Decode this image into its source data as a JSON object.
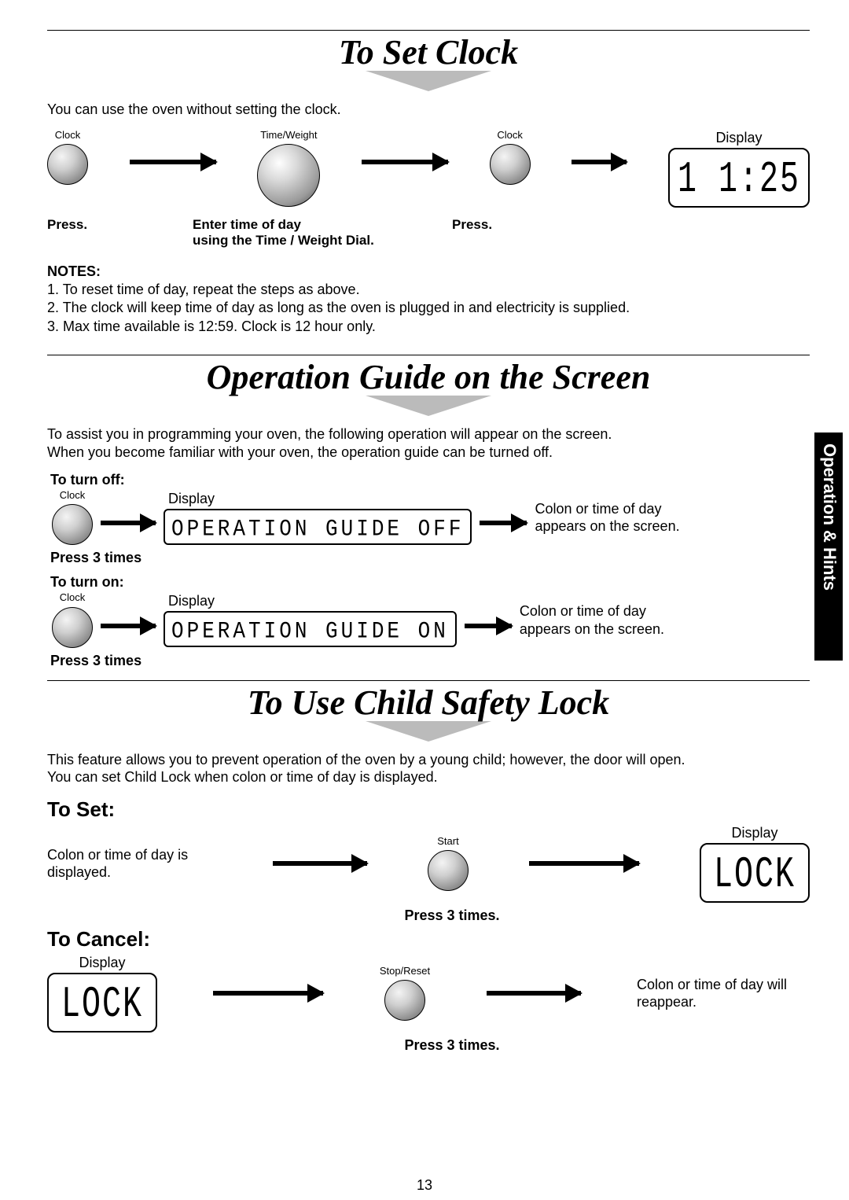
{
  "sidebar_tab": "Operation & Hints",
  "page_number": "13",
  "sections": {
    "clock": {
      "title": "To Set Clock",
      "intro": "You can use the oven without setting the clock.",
      "step1": {
        "label": "Clock",
        "caption": "Press."
      },
      "step2": {
        "label": "Time/Weight",
        "caption": "Enter time of day\nusing the Time / Weight Dial."
      },
      "step3": {
        "label": "Clock",
        "caption": "Press."
      },
      "display": {
        "label": "Display",
        "value": "1 1:25"
      },
      "notes_label": "NOTES:",
      "notes": [
        "1. To reset time of day, repeat the steps as above.",
        "2. The clock will keep time of day as long as the oven is plugged in and electricity is supplied.",
        "3. Max time available is 12:59. Clock is 12 hour only."
      ]
    },
    "opguide": {
      "title": "Operation Guide on the Screen",
      "intro": "To assist you in programming your oven, the following operation will appear on the screen.\nWhen you become familiar with your oven, the operation guide can be turned off.",
      "off": {
        "heading": "To turn off:",
        "button_label": "Clock",
        "caption": "Press 3 times",
        "display_label": "Display",
        "display_value": "OPERATION GUIDE OFF",
        "result": "Colon or time of day appears on the screen."
      },
      "on": {
        "heading": "To turn on:",
        "button_label": "Clock",
        "caption": "Press 3 times",
        "display_label": "Display",
        "display_value": "OPERATION GUIDE ON",
        "result": "Colon or time of day appears on the screen."
      }
    },
    "childlock": {
      "title": "To Use Child Safety Lock",
      "intro": "This feature allows you to prevent operation of the oven by a young child; however, the door will open.\nYou can set Child Lock when colon or time of day is displayed.",
      "set": {
        "heading": "To Set:",
        "pre_text": "Colon or time of day is displayed.",
        "button_label": "Start",
        "caption": "Press 3 times.",
        "display_label": "Display",
        "display_value": "LOCK"
      },
      "cancel": {
        "heading": "To Cancel:",
        "display_label": "Display",
        "display_value": "LOCK",
        "button_label": "Stop/Reset",
        "caption": "Press 3 times.",
        "result": "Colon or time of day will reappear."
      }
    }
  }
}
